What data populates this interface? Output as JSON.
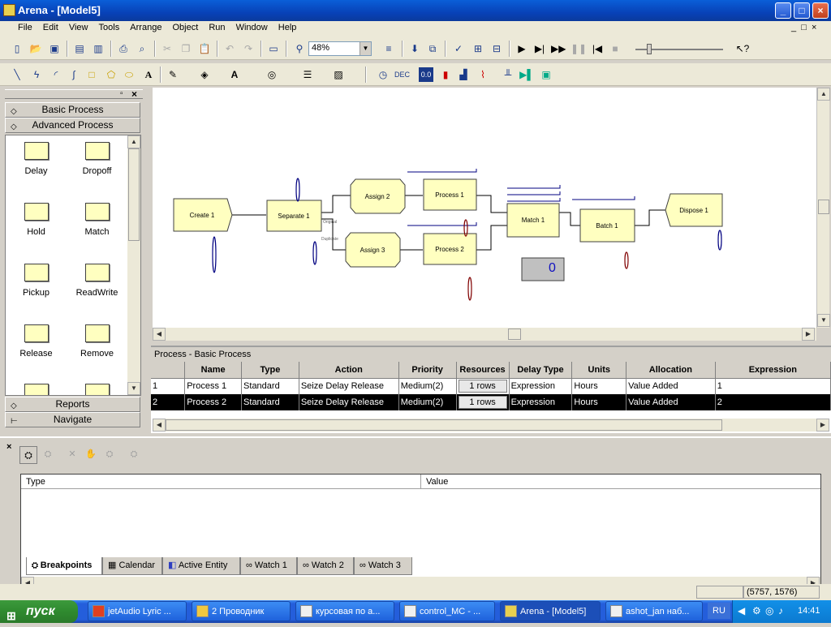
{
  "window": {
    "title": "Arena - [Model5]"
  },
  "menu": [
    "File",
    "Edit",
    "View",
    "Tools",
    "Arrange",
    "Object",
    "Run",
    "Window",
    "Help"
  ],
  "toolbar": {
    "zoom": "48%"
  },
  "project_bar": {
    "panels": [
      "Basic Process",
      "Advanced Process"
    ],
    "modules": [
      "Delay",
      "Dropoff",
      "Hold",
      "Match",
      "Pickup",
      "ReadWrite",
      "Release",
      "Remove"
    ],
    "bottom": [
      "Reports",
      "Navigate"
    ]
  },
  "flowchart": {
    "blocks": {
      "create1": "Create 1",
      "separate1": "Separate 1",
      "assign2": "Assign 2",
      "assign3": "Assign 3",
      "process1": "Process 1",
      "process2": "Process 2",
      "match1": "Match 1",
      "batch1": "Batch 1",
      "dispose1": "Dispose 1"
    },
    "sep_labels": [
      "Original",
      "Duplicate"
    ],
    "counter": "0"
  },
  "spreadsheet": {
    "title": "Process - Basic Process",
    "headers": [
      "Name",
      "Type",
      "Action",
      "Priority",
      "Resources",
      "Delay Type",
      "Units",
      "Allocation",
      "Expression"
    ],
    "rows": [
      {
        "n": "1",
        "name": "Process 1",
        "type": "Standard",
        "action": "Seize Delay Release",
        "priority": "Medium(2)",
        "resources": "1 rows",
        "delay_type": "Expression",
        "units": "Hours",
        "allocation": "Value Added",
        "expression": "1"
      },
      {
        "n": "2",
        "name": "Process 2",
        "type": "Standard",
        "action": "Seize Delay Release",
        "priority": "Medium(2)",
        "resources": "1 rows",
        "delay_type": "Expression",
        "units": "Hours",
        "allocation": "Value Added",
        "expression": "2"
      }
    ]
  },
  "debug": {
    "headers": [
      "Type",
      "Value"
    ],
    "tabs": [
      "Breakpoints",
      "Calendar",
      "Active Entity",
      "Watch 1",
      "Watch 2",
      "Watch 3"
    ]
  },
  "status": {
    "coords": "(5757, 1576)"
  },
  "taskbar": {
    "start": "пуск",
    "items": [
      "jetAudio Lyric ...",
      "2 Проводник",
      "курсовая по а...",
      "control_MC - ...",
      "Arena - [Model5]",
      "ashot_jan наб..."
    ],
    "lang": "RU",
    "clock": "14:41"
  },
  "colors": {
    "block_fill": "#ffffc0",
    "selected_row": "#000000",
    "title_blue": "#0a5fd8",
    "queue_line": "#000080"
  }
}
